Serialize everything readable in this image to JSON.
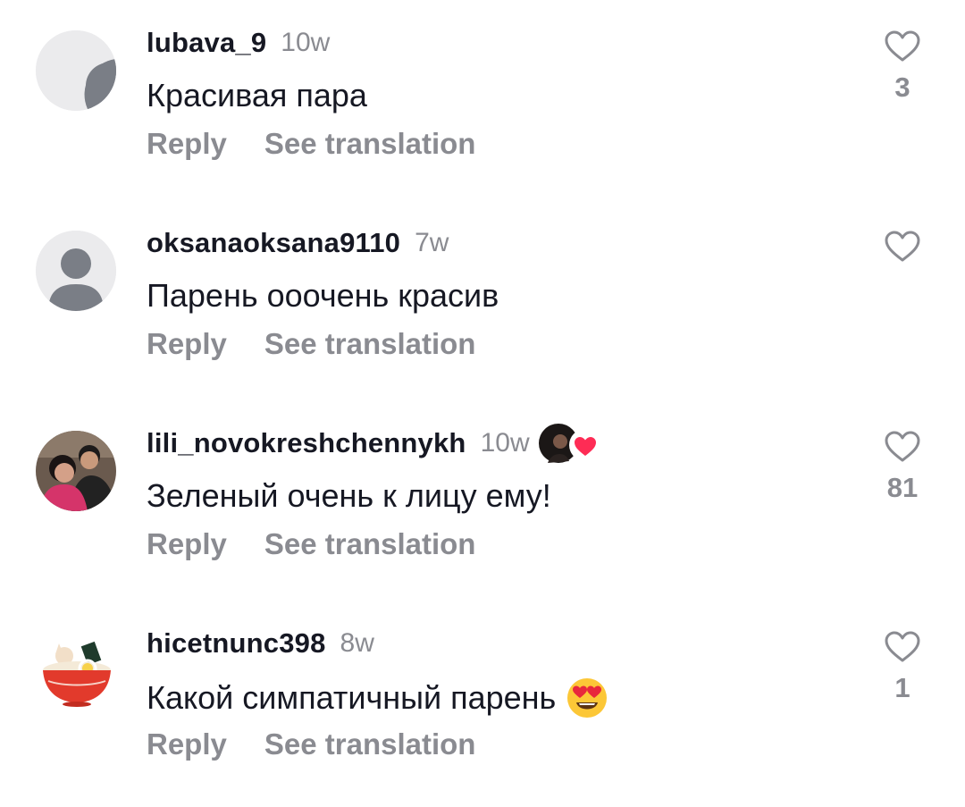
{
  "comments": [
    {
      "username": "lubava_9",
      "time": "10w",
      "text": "Красивая пара",
      "reply": "Reply",
      "translate": "See translation",
      "likes": "3",
      "avatar": "partial-circle-icon"
    },
    {
      "username": "oksanaoksana9110",
      "time": "7w",
      "text": "Парень ооочень красив",
      "reply": "Reply",
      "translate": "See translation",
      "likes": "",
      "avatar": "default-user-icon"
    },
    {
      "username": "lili_novokreshchennykh",
      "time": "10w",
      "text": "Зеленый очень к лицу ему!",
      "reply": "Reply",
      "translate": "See translation",
      "likes": "81",
      "avatar": "couple-photo",
      "liked_by_creator": true
    },
    {
      "username": "hicetnunc398",
      "time": "8w",
      "text": "Какой симпатичный парень",
      "reply": "Reply",
      "translate": "See translation",
      "likes": "1",
      "avatar": "ramen-bowl-illustration",
      "emoji": "heart-eyes-emoji"
    }
  ],
  "colors": {
    "primary_text": "#161823",
    "secondary_text": "#8a8b91",
    "heart_red": "#fe2c55"
  }
}
